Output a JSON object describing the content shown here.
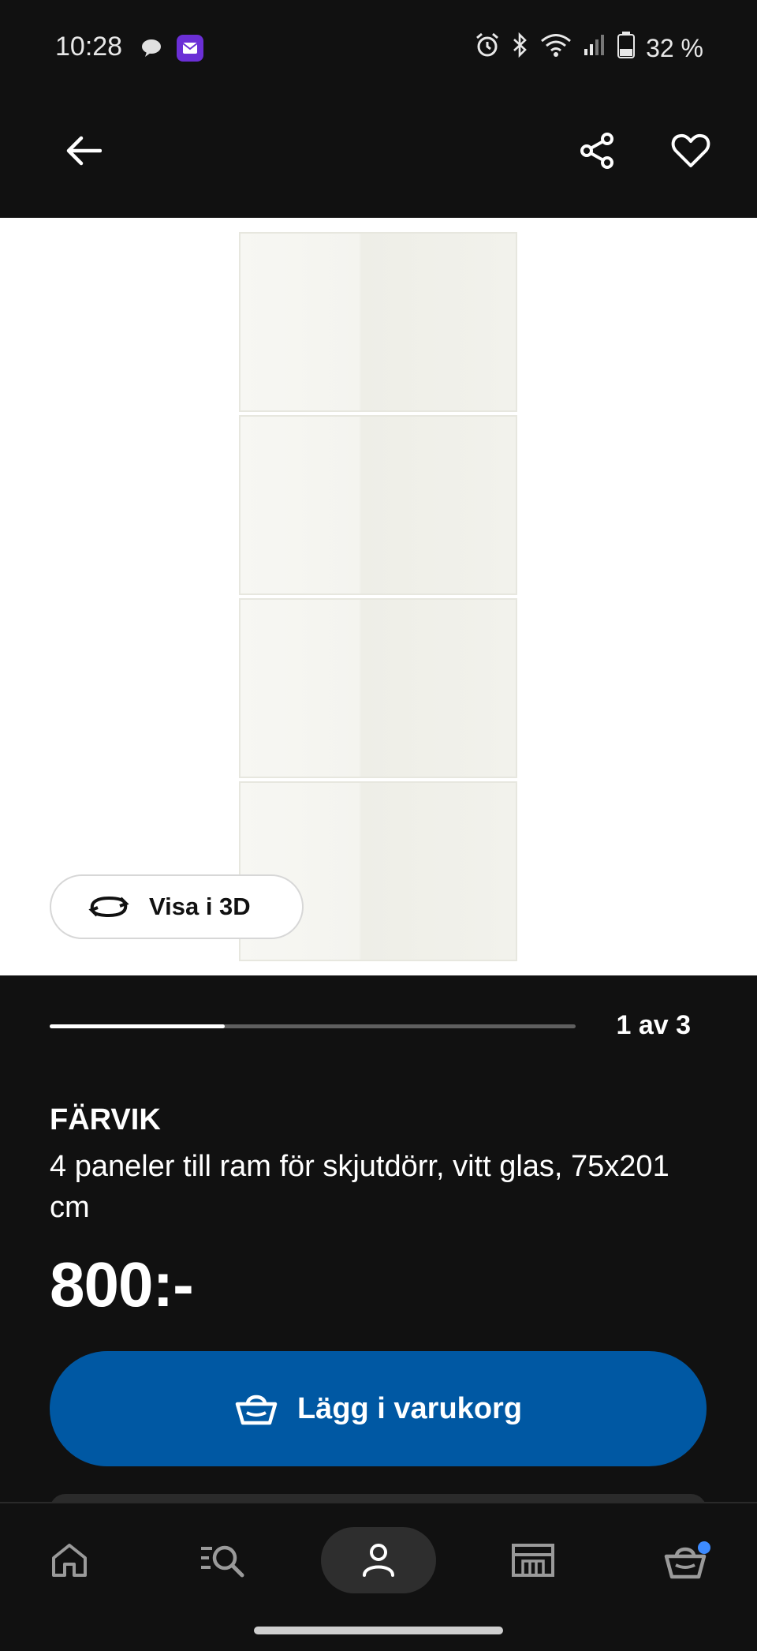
{
  "status_bar": {
    "time": "10:28",
    "battery": "32 %"
  },
  "gallery": {
    "view_3d_label": "Visa i 3D",
    "counter": "1 av 3",
    "progress_fraction": 0.333
  },
  "product": {
    "name": "FÄRVIK",
    "description": "4 paneler till ram för skjutdörr, vitt glas, 75x201 cm",
    "price": "800:-"
  },
  "cart_button": {
    "label": "Lägg i varukorg"
  },
  "colors": {
    "accent_blue": "#0058a3",
    "background": "#111111",
    "notification_dot": "#3d8bff"
  },
  "icons": {
    "top_bar": [
      "back-arrow-icon",
      "share-icon",
      "heart-icon"
    ],
    "bottom_nav": [
      "home-icon",
      "search-list-icon",
      "profile-icon",
      "store-icon",
      "cart-icon"
    ]
  }
}
